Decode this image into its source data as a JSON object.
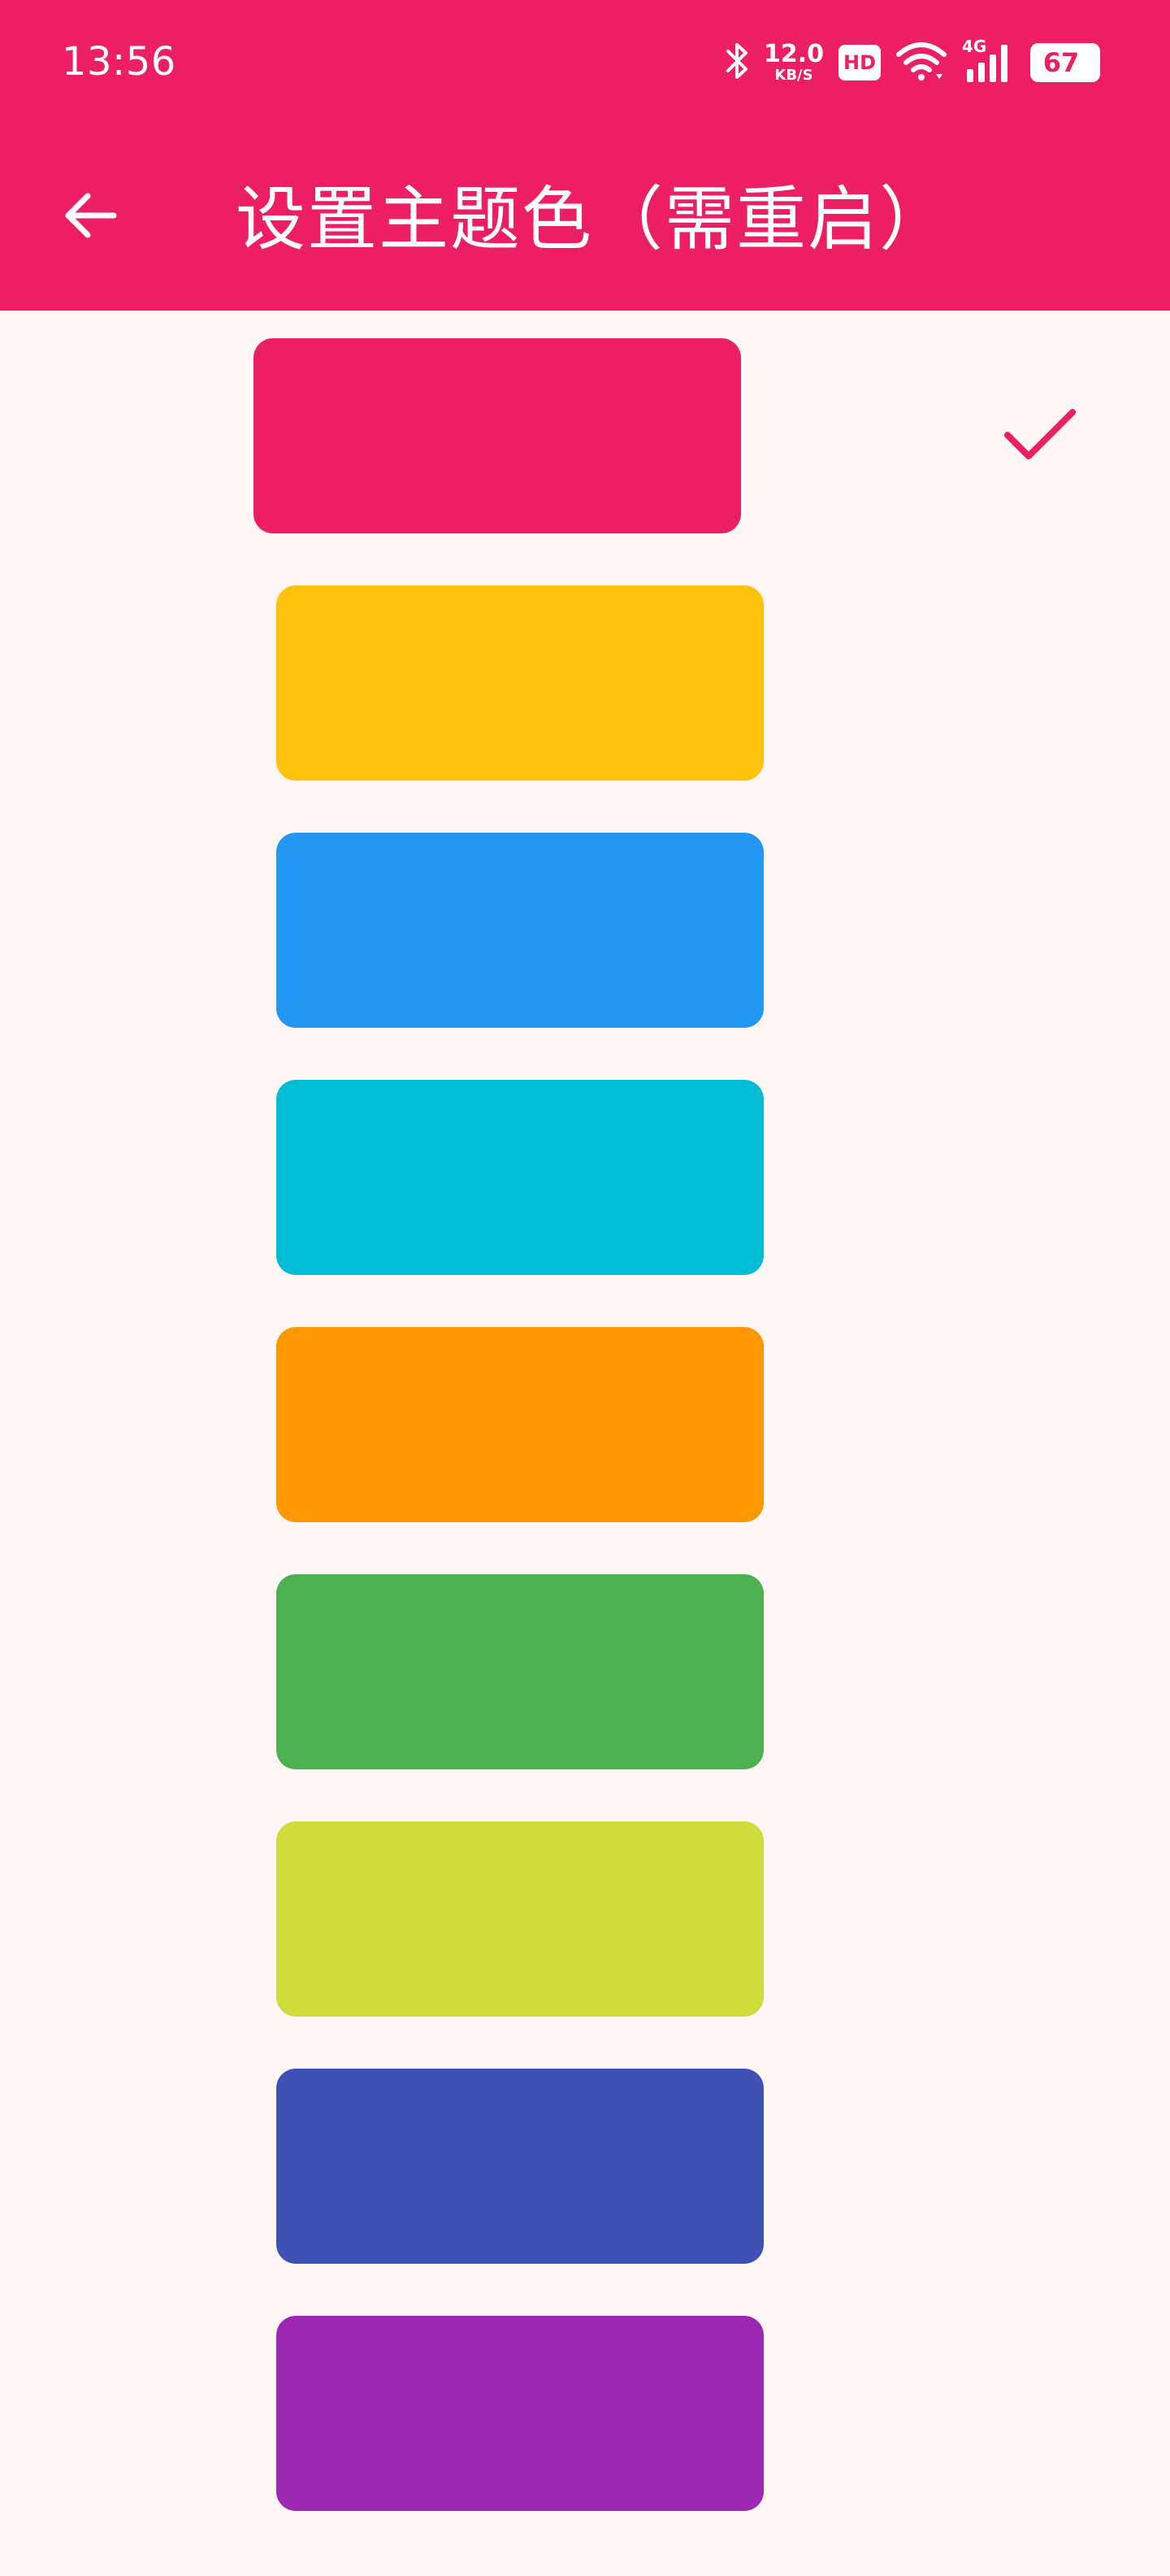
{
  "status_bar": {
    "time": "13:56",
    "net_speed_value": "12.0",
    "net_speed_unit": "KB/S",
    "hd_label": "HD",
    "network_type": "4G",
    "battery_level": "67",
    "icons": [
      "bluetooth-icon",
      "hd-icon",
      "wifi-icon",
      "cellular-signal-icon",
      "battery-icon"
    ]
  },
  "app_bar": {
    "title": "设置主题色（需重启）",
    "back_icon": "arrow-left-icon"
  },
  "theme_colors": [
    {
      "name": "pink",
      "color": "#EC1F64",
      "selected": true
    },
    {
      "name": "amber",
      "color": "#FFC10A"
    },
    {
      "name": "blue",
      "color": "#2196F3"
    },
    {
      "name": "cyan",
      "color": "#00BCD4"
    },
    {
      "name": "orange",
      "color": "#FF9800"
    },
    {
      "name": "green",
      "color": "#4CAF50"
    },
    {
      "name": "lime",
      "color": "#CDDC39"
    },
    {
      "name": "indigo",
      "color": "#3F51B5"
    },
    {
      "name": "purple",
      "color": "#9C27B0"
    }
  ],
  "colors": {
    "accent": "#EC1F64",
    "background": "#FFF6F6",
    "on_accent": "#FFFFFF"
  },
  "selected_icon": "checkmark-icon"
}
